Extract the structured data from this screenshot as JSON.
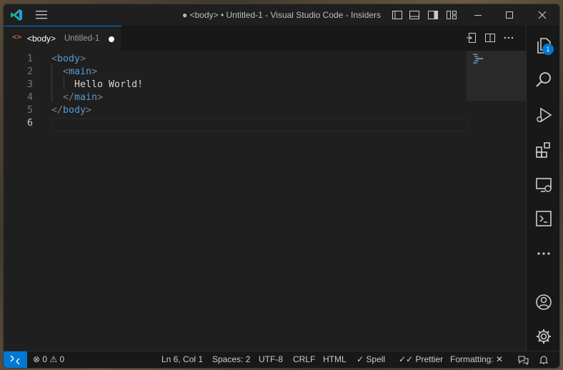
{
  "window": {
    "title": "● <body> • Untitled-1 - Visual Studio Code - Insiders"
  },
  "tab": {
    "icon": "<>",
    "name": "<body>",
    "description": "Untitled-1"
  },
  "editor": {
    "lines": [
      {
        "number": "1",
        "tokens": [
          {
            "t": "<",
            "c": "punc"
          },
          {
            "t": "body",
            "c": "tag"
          },
          {
            "t": ">",
            "c": "punc"
          }
        ]
      },
      {
        "number": "2",
        "tokens": [
          {
            "t": "  <",
            "c": "punc"
          },
          {
            "t": "main",
            "c": "tag"
          },
          {
            "t": ">",
            "c": "punc"
          }
        ]
      },
      {
        "number": "3",
        "tokens": [
          {
            "t": "    Hello World!",
            "c": "text"
          }
        ]
      },
      {
        "number": "4",
        "tokens": [
          {
            "t": "  </",
            "c": "punc"
          },
          {
            "t": "main",
            "c": "tag"
          },
          {
            "t": ">",
            "c": "punc"
          }
        ]
      },
      {
        "number": "5",
        "tokens": [
          {
            "t": "</",
            "c": "punc"
          },
          {
            "t": "body",
            "c": "tag"
          },
          {
            "t": ">",
            "c": "punc"
          }
        ]
      },
      {
        "number": "6",
        "tokens": []
      }
    ],
    "active_line": "6"
  },
  "activity_bar": {
    "explorer_badge": "1",
    "items": [
      "explorer-icon",
      "search-icon",
      "run-debug-icon",
      "extensions-icon",
      "remote-explorer-icon",
      "terminal-icon",
      "more-icon",
      "accounts-icon",
      "settings-gear-icon"
    ]
  },
  "status_bar": {
    "errors": "0",
    "warnings": "0",
    "cursor": "Ln 6, Col 1",
    "spaces": "Spaces: 2",
    "encoding": "UTF-8",
    "eol": "CRLF",
    "language": "HTML",
    "spell": "Spell",
    "prettier": "Prettier",
    "formatting": "Formatting:"
  },
  "colors": {
    "accent": "#0078d4",
    "html_tag": "#569cd6",
    "file_icon": "#e37933"
  }
}
